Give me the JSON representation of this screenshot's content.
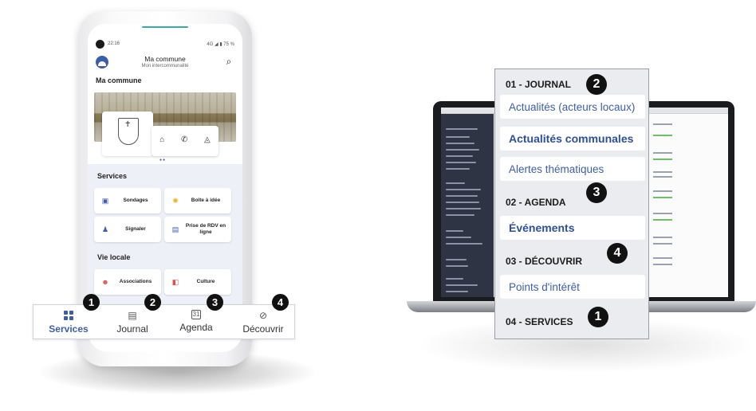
{
  "phone": {
    "status_time": "22:16",
    "status_right": "4G ◢ ▮ 75 %",
    "app_title": "Ma commune",
    "app_subtitle": "Mon intercommunalité",
    "section_commune": "Ma commune",
    "section_services": "Services",
    "section_vie_locale": "Vie locale",
    "tiles": [
      {
        "label": "Sondages",
        "icon": "chat-icon",
        "glyph": "▣",
        "color": "#3d5ea6"
      },
      {
        "label": "Boîte à idée",
        "icon": "lightbulb-icon",
        "glyph": "✺",
        "color": "#e6b32a"
      },
      {
        "label": "Signaler",
        "icon": "person-icon",
        "glyph": "♟",
        "color": "#3d5ea6"
      },
      {
        "label": "Prise de RDV en ligne",
        "icon": "calendar-icon",
        "glyph": "▤",
        "color": "#3d5ea6"
      },
      {
        "label": "Associations",
        "icon": "group-icon",
        "glyph": "☻",
        "color": "#d9534f"
      },
      {
        "label": "Culture",
        "icon": "theater-icon",
        "glyph": "◧",
        "color": "#d9534f"
      }
    ]
  },
  "bottom_nav": {
    "items": [
      {
        "label": "Services",
        "icon": "grid-icon",
        "badge": "1",
        "active": true
      },
      {
        "label": "Journal",
        "icon": "journal-icon",
        "badge": "2",
        "active": false
      },
      {
        "label": "Agenda",
        "icon": "calendar-31-icon",
        "badge": "3",
        "active": false
      },
      {
        "label": "Découvrir",
        "icon": "compass-icon",
        "badge": "4",
        "active": false
      }
    ],
    "calendar_day": "31"
  },
  "desktop_menu": {
    "sections": [
      {
        "title": "01 - JOURNAL",
        "badge": "2",
        "items": [
          {
            "label": "Actualités (acteurs locaux)",
            "bold": false
          },
          {
            "label": "Actualités communales",
            "bold": true
          },
          {
            "label": "Alertes thématiques",
            "bold": false
          }
        ]
      },
      {
        "title": "02 - AGENDA",
        "badge": "3",
        "items": [
          {
            "label": "Événements",
            "bold": true
          }
        ]
      },
      {
        "title": "03 - DÉCOUVRIR",
        "badge": "4",
        "items": [
          {
            "label": "Points d'intérêt",
            "bold": false
          }
        ]
      },
      {
        "title": "04 - SERVICES",
        "badge": "1",
        "items": []
      }
    ]
  },
  "colors": {
    "accent": "#3d5ea6",
    "badge": "#111111",
    "overlay_bg": "#eaecef"
  }
}
